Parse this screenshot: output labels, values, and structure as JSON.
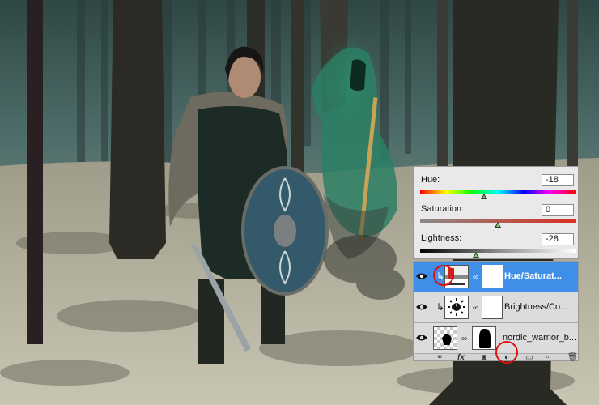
{
  "adjustments": {
    "hue": {
      "label": "Hue:",
      "value": "-18",
      "level_fraction": 0.41
    },
    "saturation": {
      "label": "Saturation:",
      "value": "0",
      "level_fraction": 0.5
    },
    "lightness": {
      "label": "Lightness:",
      "value": "-28",
      "level_fraction": 0.36
    }
  },
  "layers": [
    {
      "name": "Hue/Saturat...",
      "selected": true,
      "clipped": true,
      "icon": "hue-saturation-adjustment-icon"
    },
    {
      "name": "Brightness/Co...",
      "selected": false,
      "clipped": true,
      "icon": "brightness-contrast-adjustment-icon"
    },
    {
      "name": "nordic_warrior_b...",
      "selected": false,
      "clipped": false,
      "icon": "image-layer-icon"
    }
  ],
  "footer_icons": [
    "link-layers-icon",
    "fx-icon",
    "add-mask-icon",
    "new-adjustment-layer-icon",
    "new-group-icon",
    "new-layer-icon",
    "delete-layer-icon"
  ],
  "footer_fx": "fx",
  "colors": {
    "selected_layer": "#3f8fe8",
    "highlight_circle": "#e01010"
  }
}
